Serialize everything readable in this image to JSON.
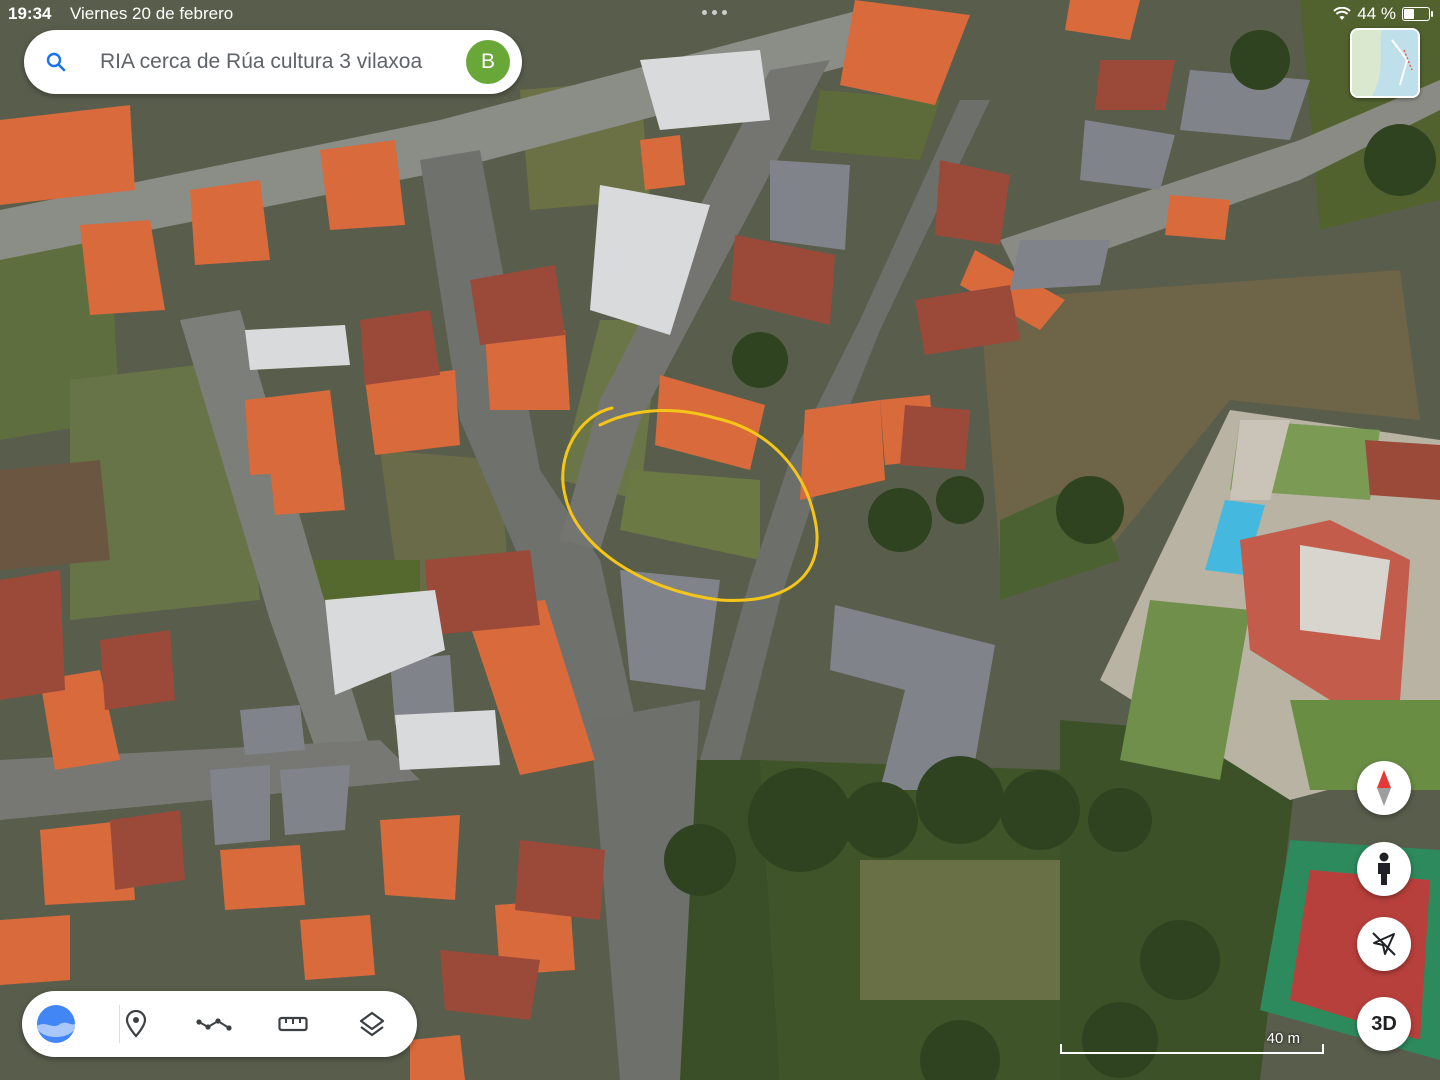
{
  "status_bar": {
    "time": "19:34",
    "date": "Viernes 20 de febrero",
    "battery_percent": "44 %",
    "battery_level": 0.44
  },
  "search": {
    "query": "RIA cerca de Rúa cultura 3 vilaxoa",
    "icon": "search-icon"
  },
  "account": {
    "initial": "B",
    "color": "#6aa739"
  },
  "map_controls": {
    "compass_icon": "compass-icon",
    "pegman_icon": "pegman-icon",
    "location_icon": "location-off-icon",
    "view_3d_label": "3D"
  },
  "toolbar": {
    "items": [
      "earth-icon",
      "pin-icon",
      "path-icon",
      "ruler-icon",
      "layers-icon"
    ]
  },
  "scale": {
    "label": "40 m"
  },
  "annotation": {
    "color": "#f5c518"
  }
}
